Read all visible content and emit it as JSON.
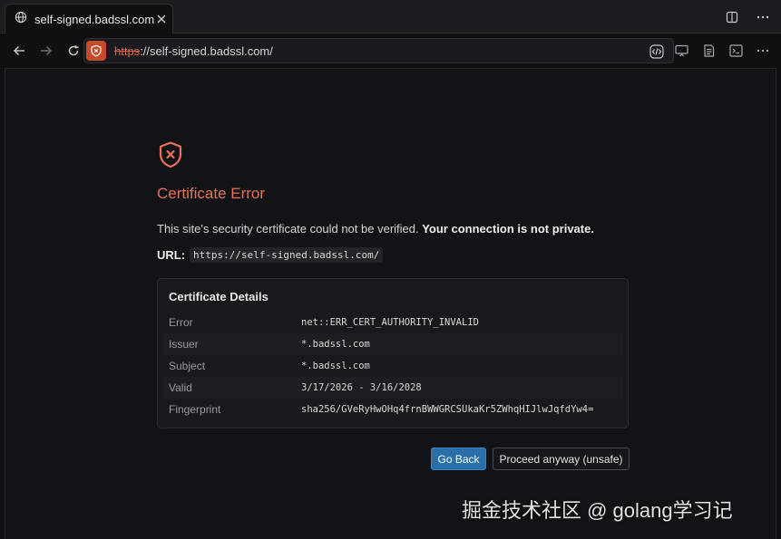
{
  "tab": {
    "title": "self-signed.badssl.com"
  },
  "address_bar": {
    "scheme": "https",
    "rest": "://self-signed.badssl.com/"
  },
  "error_page": {
    "title": "Certificate Error",
    "message_plain": "This site's security certificate could not be verified. ",
    "message_bold": "Your connection is not private.",
    "url_label": "URL:",
    "url_value": "https://self-signed.badssl.com/",
    "details": {
      "title": "Certificate Details",
      "rows": [
        {
          "key": "Error",
          "value": "net::ERR_CERT_AUTHORITY_INVALID"
        },
        {
          "key": "Issuer",
          "value": "*.badssl.com"
        },
        {
          "key": "Subject",
          "value": "*.badssl.com"
        },
        {
          "key": "Valid",
          "value": "3/17/2026 - 3/16/2028"
        },
        {
          "key": "Fingerprint",
          "value": "sha256/GVeRyHwOHq4frnBWWGRCSUkaKr5ZWhqHIJlwJqfdYw4="
        }
      ]
    },
    "buttons": {
      "back": "Go Back",
      "proceed": "Proceed anyway (unsafe)"
    }
  },
  "watermark": "掘金技术社区 @ golang学习记",
  "colors": {
    "accent_error": "#e7715a",
    "primary_button": "#2a6fa8",
    "shield_badge": "#c74a2a"
  },
  "icons": [
    "globe-icon",
    "close-icon",
    "split-view-icon",
    "more-icon",
    "back-icon",
    "forward-icon",
    "reload-icon",
    "site-shield-icon",
    "code-icon",
    "cast-icon",
    "reader-icon",
    "terminal-icon",
    "error-shield-icon"
  ]
}
